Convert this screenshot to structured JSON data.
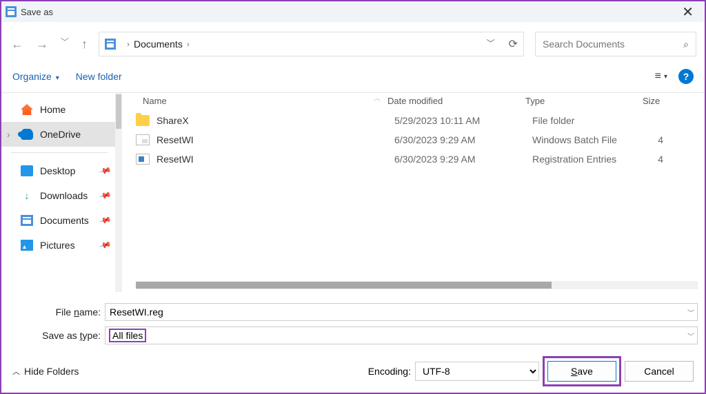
{
  "window": {
    "title": "Save as"
  },
  "breadcrumb": {
    "location": "Documents"
  },
  "search": {
    "placeholder": "Search Documents"
  },
  "toolbar": {
    "organize": "Organize",
    "newfolder": "New folder"
  },
  "sidebar": {
    "items": [
      {
        "label": "Home"
      },
      {
        "label": "OneDrive"
      },
      {
        "label": "Desktop"
      },
      {
        "label": "Downloads"
      },
      {
        "label": "Documents"
      },
      {
        "label": "Pictures"
      }
    ]
  },
  "columns": {
    "name": "Name",
    "date": "Date modified",
    "type": "Type",
    "size": "Size"
  },
  "files": [
    {
      "name": "ShareX",
      "date": "5/29/2023 10:11 AM",
      "type": "File folder",
      "size": ""
    },
    {
      "name": "ResetWI",
      "date": "6/30/2023 9:29 AM",
      "type": "Windows Batch File",
      "size": "4"
    },
    {
      "name": "ResetWI",
      "date": "6/30/2023 9:29 AM",
      "type": "Registration Entries",
      "size": "4"
    }
  ],
  "form": {
    "filename_label": "File name:",
    "filename_value": "ResetWI.reg",
    "type_label": "Save as type:",
    "type_value": "All files",
    "encoding_label": "Encoding:",
    "encoding_value": "UTF-8"
  },
  "footer": {
    "hide_folders": "Hide Folders",
    "save": "Save",
    "cancel": "Cancel"
  }
}
